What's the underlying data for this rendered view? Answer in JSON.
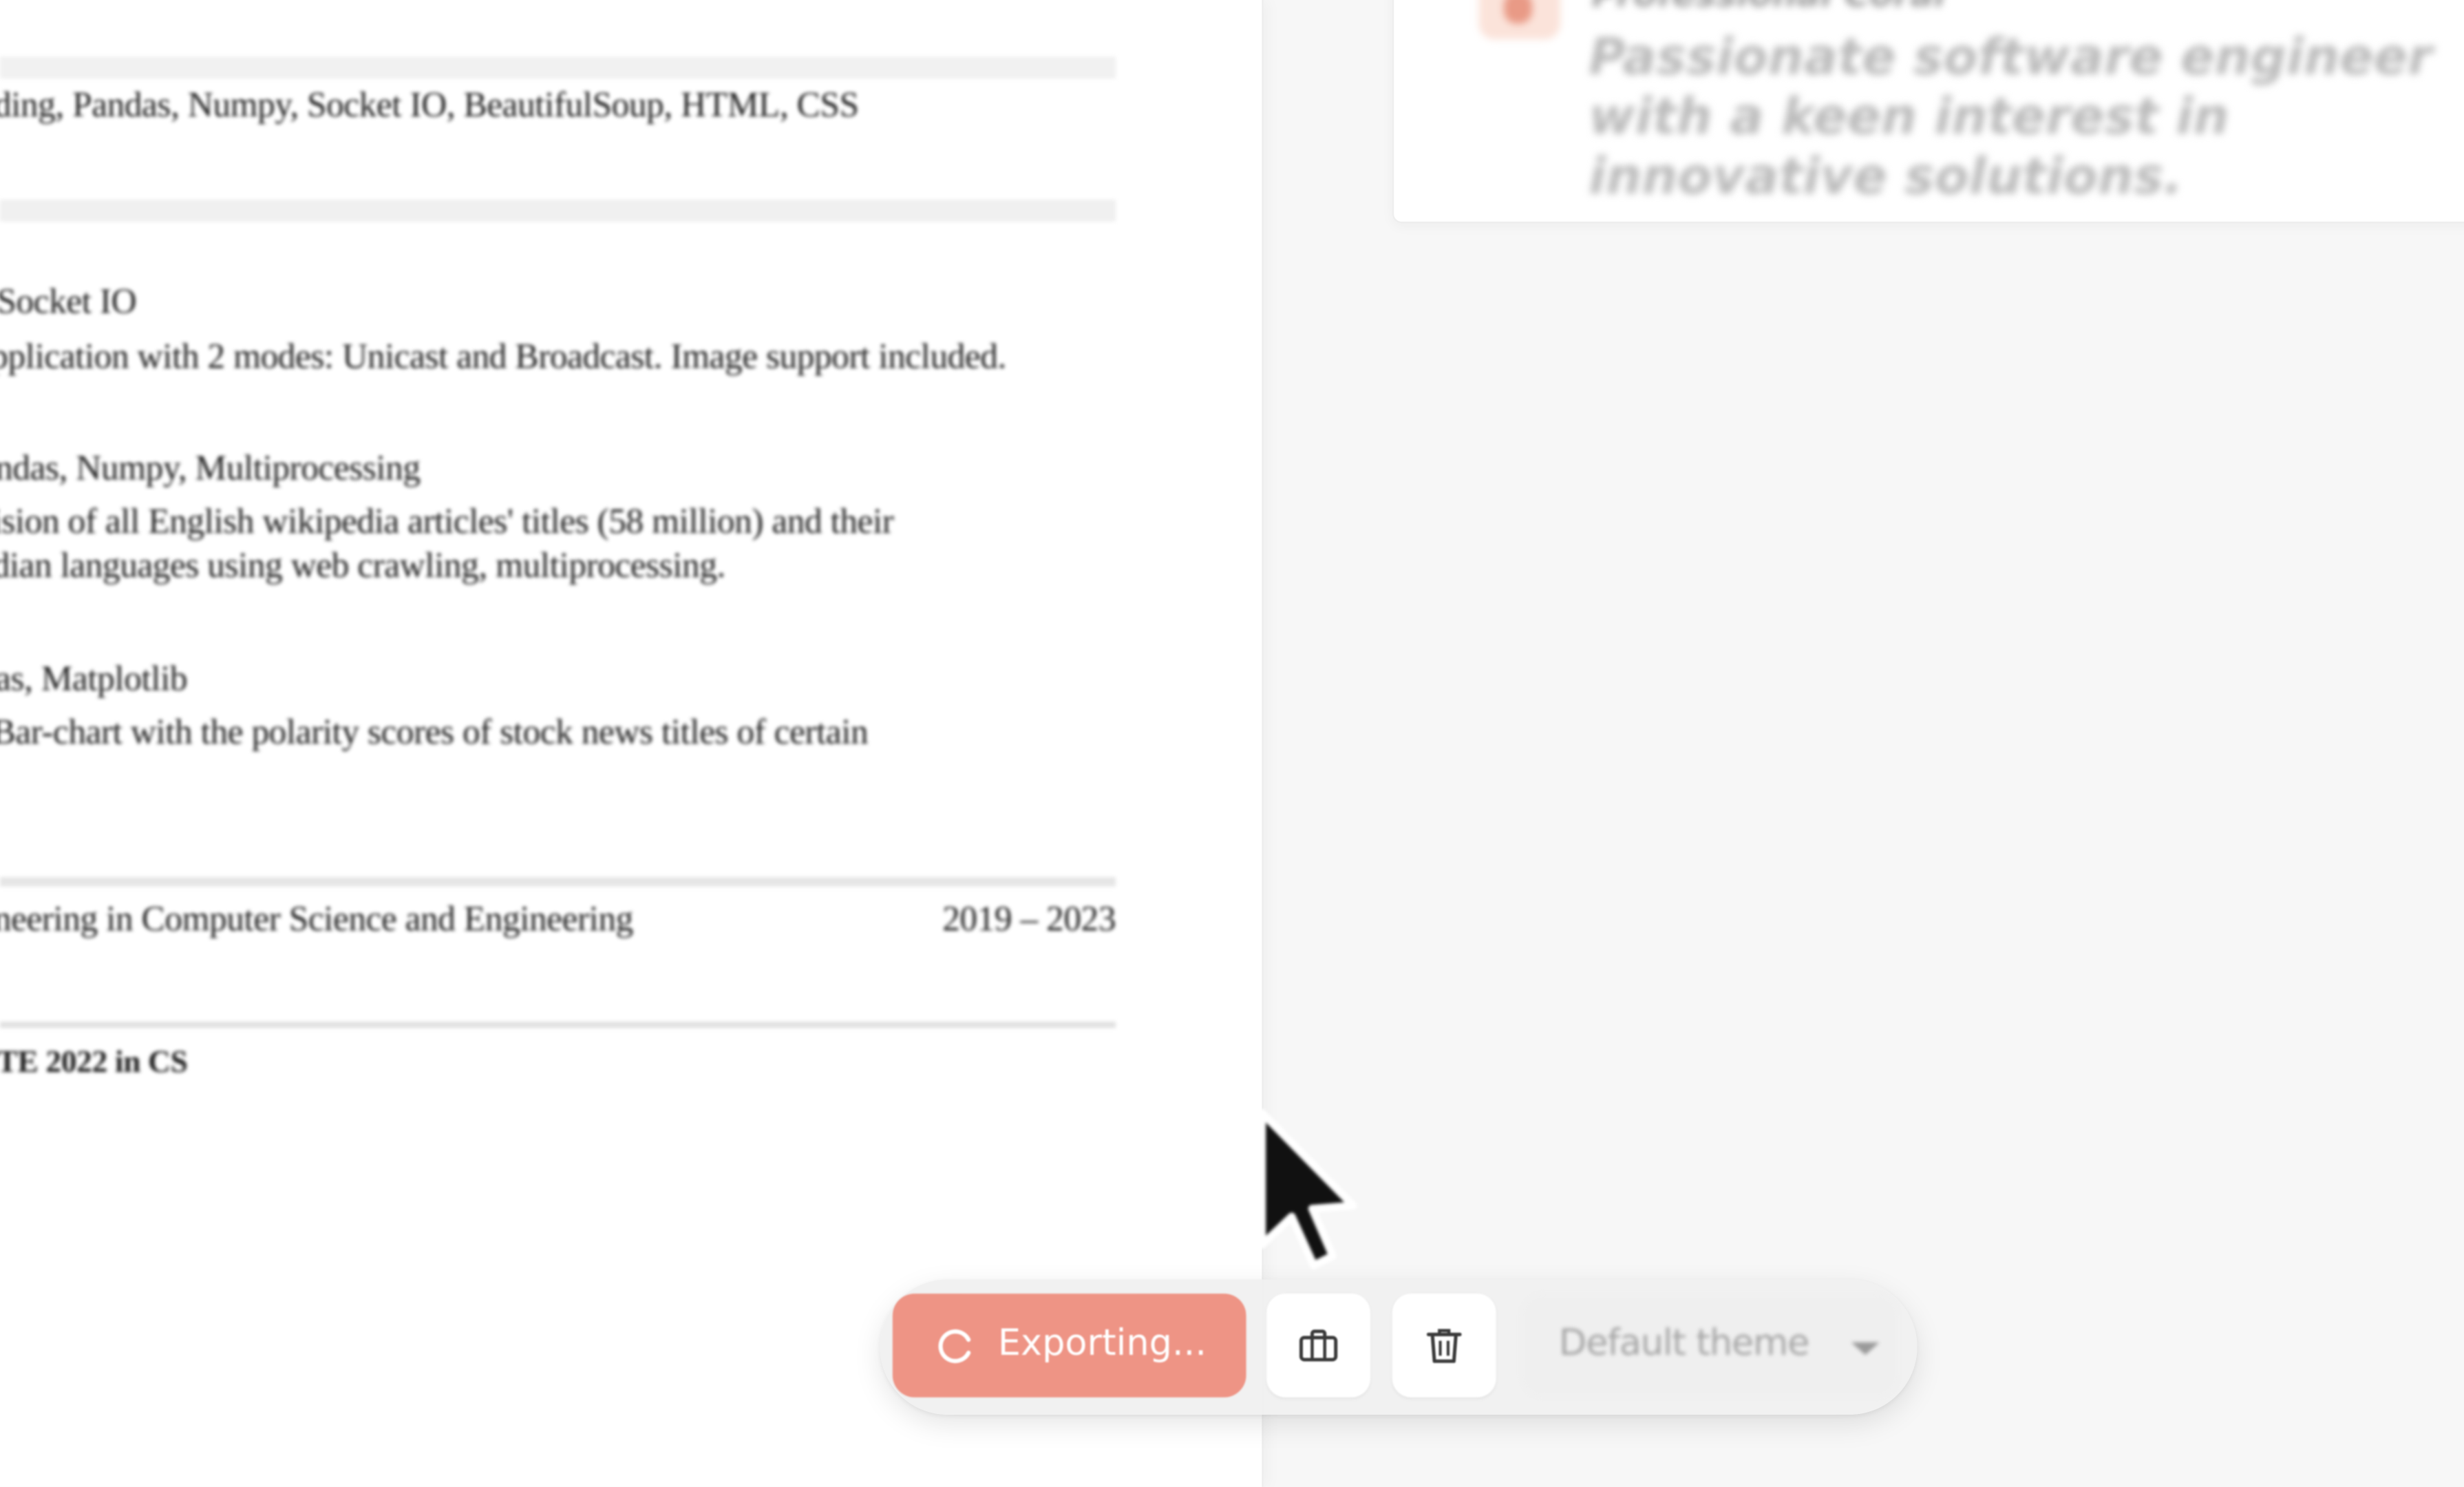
{
  "resume": {
    "lines": [
      "ding, Pandas, Numpy, Socket IO, BeautifulSoup, HTML, CSS",
      "Socket IO",
      "pplication with 2 modes: Unicast and Broadcast. Image support included.",
      "ndas, Numpy, Multiprocessing",
      "ision of all English wikipedia articles' titles (58 million) and their",
      "dian languages using web crawling, multiprocessing.",
      "as, Matplotlib",
      "Bar-chart with the polarity scores of stock news titles of certain",
      "neering in Computer Science and Engineering",
      "2019 – 2023",
      "TE 2022 in CS"
    ]
  },
  "theme_card": {
    "name": "Professional Coral",
    "description": "Passionate software engineer with a keen interest in innovative solutions."
  },
  "toolbar": {
    "export_label": "Exporting...",
    "theme_select_value": "Default theme"
  },
  "colors": {
    "accent": "#ee9485",
    "accent_light": "#fbe3da",
    "background": "#f7f7f7"
  },
  "icons": {
    "export_spinner": "spinner-icon",
    "briefcase": "briefcase-icon",
    "trash": "trash-icon",
    "caret": "chevron-down-icon",
    "cursor": "mouse-cursor-icon"
  }
}
